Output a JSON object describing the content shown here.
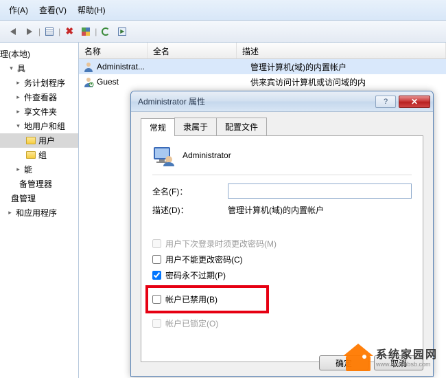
{
  "menu": {
    "action": "作(A)",
    "view": "查看(V)",
    "help": "帮助(H)"
  },
  "tree": {
    "root": "理(本地)",
    "tools": "具",
    "scheduler": "务计划程序",
    "eventviewer": "件查看器",
    "shared": "享文件夹",
    "localusers": "地用户和组",
    "users": "用户",
    "groups": "组",
    "perf": "能",
    "devmgr": "备管理器",
    "disk": "盘管理",
    "svcapps": "和应用程序"
  },
  "list": {
    "col_name": "名称",
    "col_full": "全名",
    "col_desc": "描述",
    "rows": [
      {
        "name": "Administrat...",
        "desc": "管理计算机(域)的内置帐户"
      },
      {
        "name": "Guest",
        "desc": "供来宾访问计算机或访问域的内"
      }
    ]
  },
  "dialog": {
    "title": "Administrator 属性",
    "tabs": {
      "general": "常规",
      "member": "隶属于",
      "profile": "配置文件"
    },
    "username": "Administrator",
    "fullname_label": "全名(F)：",
    "fullname_value": "",
    "desc_label": "描述(D)：",
    "desc_value": "管理计算机(域)的内置帐户",
    "chk_mustchange": "用户下次登录时须更改密码(M)",
    "chk_cannotchange": "用户不能更改密码(C)",
    "chk_neverexpire": "密码永不过期(P)",
    "chk_disabled": "帐户已禁用(B)",
    "chk_locked": "帐户已锁定(O)",
    "btn_ok": "确定",
    "btn_cancel": "取消"
  },
  "watermark": {
    "cn": "系统家园网",
    "en": "www.hnzkhbsb.com"
  }
}
